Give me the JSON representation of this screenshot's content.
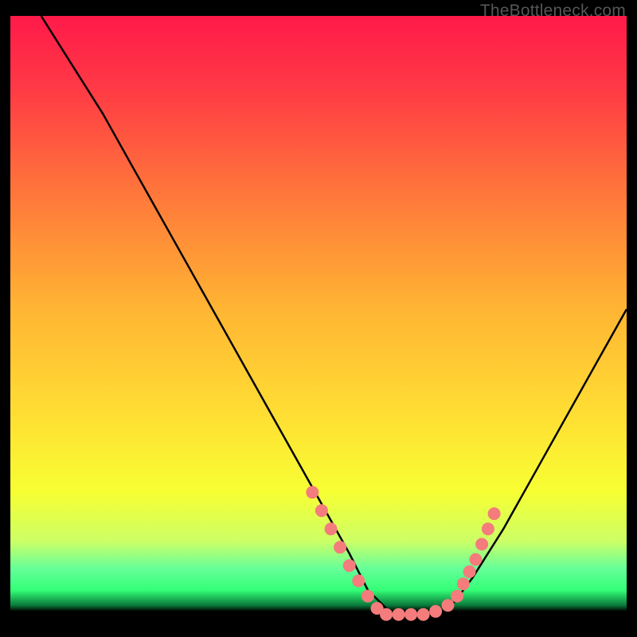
{
  "watermark": "TheBottleneck.com",
  "chart_data": {
    "type": "line",
    "title": "",
    "xlabel": "",
    "ylabel": "",
    "xlim": [
      0,
      100
    ],
    "ylim": [
      0,
      100
    ],
    "grid": false,
    "legend": false,
    "background_gradient": {
      "top_color": "#ff1a4a",
      "mid_color": "#ffe033",
      "green_band_color": "#33ff77",
      "bottom_color": "#000000"
    },
    "series": [
      {
        "name": "bottleneck-curve",
        "color": "#000000",
        "x": [
          5,
          10,
          15,
          20,
          25,
          30,
          35,
          40,
          45,
          50,
          55,
          58,
          62,
          66,
          70,
          72,
          75,
          80,
          85,
          90,
          95,
          100
        ],
        "y": [
          100,
          92,
          84,
          75,
          66,
          57,
          48,
          39,
          30,
          21,
          12,
          6,
          2,
          2,
          2,
          4,
          8,
          16,
          25,
          34,
          43,
          52
        ]
      },
      {
        "name": "marker-band-left",
        "type": "scatter",
        "color": "#f47c7c",
        "x": [
          49,
          50.5,
          52,
          53.5,
          55,
          56.5,
          58,
          59.5
        ],
        "y": [
          22,
          19,
          16,
          13,
          10,
          7.5,
          5,
          3
        ]
      },
      {
        "name": "marker-band-bottom",
        "type": "scatter",
        "color": "#f47c7c",
        "x": [
          61,
          63,
          65,
          67,
          69,
          71
        ],
        "y": [
          2,
          2,
          2,
          2,
          2.5,
          3.5
        ]
      },
      {
        "name": "marker-band-right",
        "type": "scatter",
        "color": "#f47c7c",
        "x": [
          72.5,
          73.5,
          74.5,
          75.5,
          76.5,
          77.5,
          78.5
        ],
        "y": [
          5,
          7,
          9,
          11,
          13.5,
          16,
          18.5
        ]
      }
    ]
  }
}
